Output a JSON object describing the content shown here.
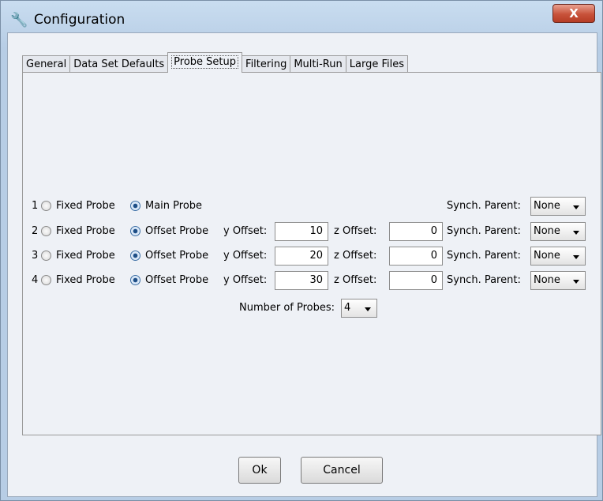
{
  "window": {
    "title": "Configuration",
    "close_label": "X"
  },
  "tabs": [
    "General",
    "Data Set Defaults",
    "Probe Setup",
    "Filtering",
    "Multi-Run",
    "Large Files"
  ],
  "active_tab": "Probe Setup",
  "labels": {
    "fixed_probe": "Fixed Probe",
    "main_probe": "Main Probe",
    "offset_probe": "Offset Probe",
    "y_offset": "y Offset:",
    "z_offset": "z Offset:",
    "synch_parent": "Synch. Parent:"
  },
  "probes": [
    {
      "index": "1",
      "mode": "Main Probe",
      "synch_parent": "None"
    },
    {
      "index": "2",
      "mode": "Offset Probe",
      "y_offset": "10",
      "z_offset": "0",
      "synch_parent": "None"
    },
    {
      "index": "3",
      "mode": "Offset Probe",
      "y_offset": "20",
      "z_offset": "0",
      "synch_parent": "None"
    },
    {
      "index": "4",
      "mode": "Offset Probe",
      "y_offset": "30",
      "z_offset": "0",
      "synch_parent": "None"
    }
  ],
  "number_of_probes": {
    "label": "Number of Probes:",
    "value": "4"
  },
  "buttons": {
    "ok": "Ok",
    "cancel": "Cancel"
  },
  "colors": {
    "selected_radio": "#1e4e86",
    "close_button": "#c8523a",
    "title_gradient": "#c9ddf0"
  }
}
